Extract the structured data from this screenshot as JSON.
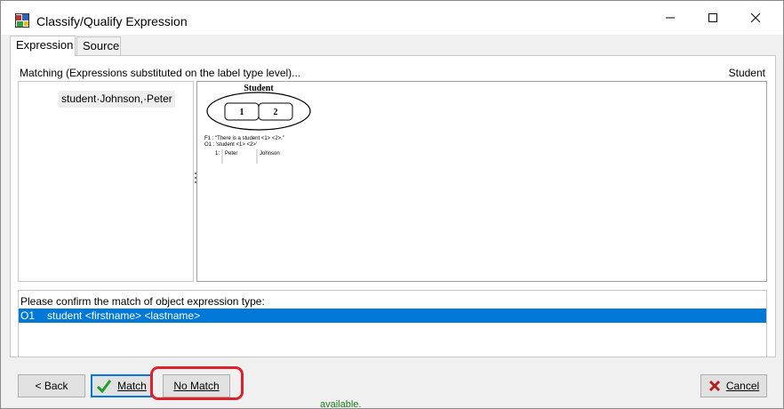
{
  "window": {
    "title": "Classify/Qualify Expression"
  },
  "tabs": [
    {
      "label": "Expression",
      "active": true
    },
    {
      "label": "Source",
      "active": false
    }
  ],
  "matching": {
    "header": "Matching (Expressions substituted on the label type level)...",
    "type_label": "Student",
    "left_item": "student·Johnson,·Peter"
  },
  "diagram": {
    "object_type": "Student",
    "roles": [
      "1",
      "2"
    ],
    "fact_lines": [
      "F1 : \"There is a student <1> <2>.\"",
      "O1 : 'student <1> <2>'"
    ],
    "population": {
      "row_index": "1:",
      "values": [
        "Peter",
        "Johnson"
      ]
    }
  },
  "confirm": {
    "label": "Please confirm the match of object expression type:",
    "items": [
      {
        "code": "O1",
        "expression": "student <firstname> <lastname>",
        "selected": true
      }
    ]
  },
  "buttons": {
    "back": "< Back",
    "match": "Match",
    "no_match": "No Match",
    "cancel": "Cancel"
  },
  "background_fragment": "available.",
  "colors": {
    "selection": "#0078d7",
    "highlight": "#e0202a",
    "check": "#1e9e2e",
    "cancel_x": "#b22222"
  }
}
